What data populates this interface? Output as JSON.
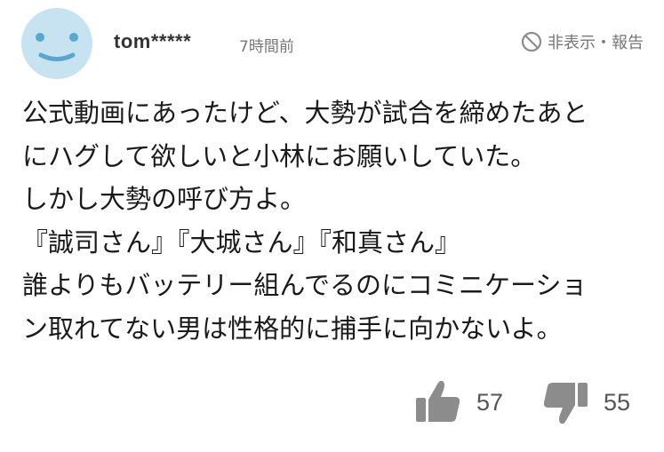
{
  "comment": {
    "username": "tom*****",
    "timestamp": "7時間前",
    "hide_report_label": "非表示・報告",
    "body_lines": [
      "公式動画にあったけど、大勢が試合を締めたあと",
      "にハグして欲しいと小林にお願いしていた。",
      "しかし大勢の呼び方よ。",
      "『誠司さん』『大城さん』『和真さん』",
      "誰よりもバッテリー組んでるのにコミニケーショ",
      "ン取れてない男は性格的に捕手に向かないよ。"
    ],
    "likes": "57",
    "dislikes": "55"
  },
  "colors": {
    "avatar_bg": "#c7e3f1",
    "avatar_face": "#5aa6cf",
    "icon_gray": "#8c8c8c",
    "muted_text": "#777777"
  },
  "icons": {
    "avatar": "smiley-face-icon",
    "hide_report": "prohibited-circle-icon",
    "like": "thumbs-up-icon",
    "dislike": "thumbs-down-icon"
  }
}
